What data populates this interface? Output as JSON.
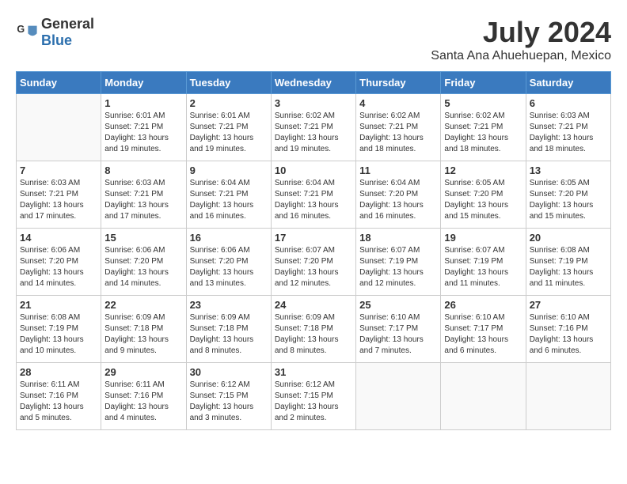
{
  "logo": {
    "general": "General",
    "blue": "Blue"
  },
  "header": {
    "month": "July 2024",
    "location": "Santa Ana Ahuehuepan, Mexico"
  },
  "weekdays": [
    "Sunday",
    "Monday",
    "Tuesday",
    "Wednesday",
    "Thursday",
    "Friday",
    "Saturday"
  ],
  "weeks": [
    [
      {
        "day": "",
        "sunrise": "",
        "sunset": "",
        "daylight": ""
      },
      {
        "day": "1",
        "sunrise": "Sunrise: 6:01 AM",
        "sunset": "Sunset: 7:21 PM",
        "daylight": "Daylight: 13 hours and 19 minutes."
      },
      {
        "day": "2",
        "sunrise": "Sunrise: 6:01 AM",
        "sunset": "Sunset: 7:21 PM",
        "daylight": "Daylight: 13 hours and 19 minutes."
      },
      {
        "day": "3",
        "sunrise": "Sunrise: 6:02 AM",
        "sunset": "Sunset: 7:21 PM",
        "daylight": "Daylight: 13 hours and 19 minutes."
      },
      {
        "day": "4",
        "sunrise": "Sunrise: 6:02 AM",
        "sunset": "Sunset: 7:21 PM",
        "daylight": "Daylight: 13 hours and 18 minutes."
      },
      {
        "day": "5",
        "sunrise": "Sunrise: 6:02 AM",
        "sunset": "Sunset: 7:21 PM",
        "daylight": "Daylight: 13 hours and 18 minutes."
      },
      {
        "day": "6",
        "sunrise": "Sunrise: 6:03 AM",
        "sunset": "Sunset: 7:21 PM",
        "daylight": "Daylight: 13 hours and 18 minutes."
      }
    ],
    [
      {
        "day": "7",
        "sunrise": "Sunrise: 6:03 AM",
        "sunset": "Sunset: 7:21 PM",
        "daylight": "Daylight: 13 hours and 17 minutes."
      },
      {
        "day": "8",
        "sunrise": "Sunrise: 6:03 AM",
        "sunset": "Sunset: 7:21 PM",
        "daylight": "Daylight: 13 hours and 17 minutes."
      },
      {
        "day": "9",
        "sunrise": "Sunrise: 6:04 AM",
        "sunset": "Sunset: 7:21 PM",
        "daylight": "Daylight: 13 hours and 16 minutes."
      },
      {
        "day": "10",
        "sunrise": "Sunrise: 6:04 AM",
        "sunset": "Sunset: 7:21 PM",
        "daylight": "Daylight: 13 hours and 16 minutes."
      },
      {
        "day": "11",
        "sunrise": "Sunrise: 6:04 AM",
        "sunset": "Sunset: 7:20 PM",
        "daylight": "Daylight: 13 hours and 16 minutes."
      },
      {
        "day": "12",
        "sunrise": "Sunrise: 6:05 AM",
        "sunset": "Sunset: 7:20 PM",
        "daylight": "Daylight: 13 hours and 15 minutes."
      },
      {
        "day": "13",
        "sunrise": "Sunrise: 6:05 AM",
        "sunset": "Sunset: 7:20 PM",
        "daylight": "Daylight: 13 hours and 15 minutes."
      }
    ],
    [
      {
        "day": "14",
        "sunrise": "Sunrise: 6:06 AM",
        "sunset": "Sunset: 7:20 PM",
        "daylight": "Daylight: 13 hours and 14 minutes."
      },
      {
        "day": "15",
        "sunrise": "Sunrise: 6:06 AM",
        "sunset": "Sunset: 7:20 PM",
        "daylight": "Daylight: 13 hours and 14 minutes."
      },
      {
        "day": "16",
        "sunrise": "Sunrise: 6:06 AM",
        "sunset": "Sunset: 7:20 PM",
        "daylight": "Daylight: 13 hours and 13 minutes."
      },
      {
        "day": "17",
        "sunrise": "Sunrise: 6:07 AM",
        "sunset": "Sunset: 7:20 PM",
        "daylight": "Daylight: 13 hours and 12 minutes."
      },
      {
        "day": "18",
        "sunrise": "Sunrise: 6:07 AM",
        "sunset": "Sunset: 7:19 PM",
        "daylight": "Daylight: 13 hours and 12 minutes."
      },
      {
        "day": "19",
        "sunrise": "Sunrise: 6:07 AM",
        "sunset": "Sunset: 7:19 PM",
        "daylight": "Daylight: 13 hours and 11 minutes."
      },
      {
        "day": "20",
        "sunrise": "Sunrise: 6:08 AM",
        "sunset": "Sunset: 7:19 PM",
        "daylight": "Daylight: 13 hours and 11 minutes."
      }
    ],
    [
      {
        "day": "21",
        "sunrise": "Sunrise: 6:08 AM",
        "sunset": "Sunset: 7:19 PM",
        "daylight": "Daylight: 13 hours and 10 minutes."
      },
      {
        "day": "22",
        "sunrise": "Sunrise: 6:09 AM",
        "sunset": "Sunset: 7:18 PM",
        "daylight": "Daylight: 13 hours and 9 minutes."
      },
      {
        "day": "23",
        "sunrise": "Sunrise: 6:09 AM",
        "sunset": "Sunset: 7:18 PM",
        "daylight": "Daylight: 13 hours and 8 minutes."
      },
      {
        "day": "24",
        "sunrise": "Sunrise: 6:09 AM",
        "sunset": "Sunset: 7:18 PM",
        "daylight": "Daylight: 13 hours and 8 minutes."
      },
      {
        "day": "25",
        "sunrise": "Sunrise: 6:10 AM",
        "sunset": "Sunset: 7:17 PM",
        "daylight": "Daylight: 13 hours and 7 minutes."
      },
      {
        "day": "26",
        "sunrise": "Sunrise: 6:10 AM",
        "sunset": "Sunset: 7:17 PM",
        "daylight": "Daylight: 13 hours and 6 minutes."
      },
      {
        "day": "27",
        "sunrise": "Sunrise: 6:10 AM",
        "sunset": "Sunset: 7:16 PM",
        "daylight": "Daylight: 13 hours and 6 minutes."
      }
    ],
    [
      {
        "day": "28",
        "sunrise": "Sunrise: 6:11 AM",
        "sunset": "Sunset: 7:16 PM",
        "daylight": "Daylight: 13 hours and 5 minutes."
      },
      {
        "day": "29",
        "sunrise": "Sunrise: 6:11 AM",
        "sunset": "Sunset: 7:16 PM",
        "daylight": "Daylight: 13 hours and 4 minutes."
      },
      {
        "day": "30",
        "sunrise": "Sunrise: 6:12 AM",
        "sunset": "Sunset: 7:15 PM",
        "daylight": "Daylight: 13 hours and 3 minutes."
      },
      {
        "day": "31",
        "sunrise": "Sunrise: 6:12 AM",
        "sunset": "Sunset: 7:15 PM",
        "daylight": "Daylight: 13 hours and 2 minutes."
      },
      {
        "day": "",
        "sunrise": "",
        "sunset": "",
        "daylight": ""
      },
      {
        "day": "",
        "sunrise": "",
        "sunset": "",
        "daylight": ""
      },
      {
        "day": "",
        "sunrise": "",
        "sunset": "",
        "daylight": ""
      }
    ]
  ]
}
